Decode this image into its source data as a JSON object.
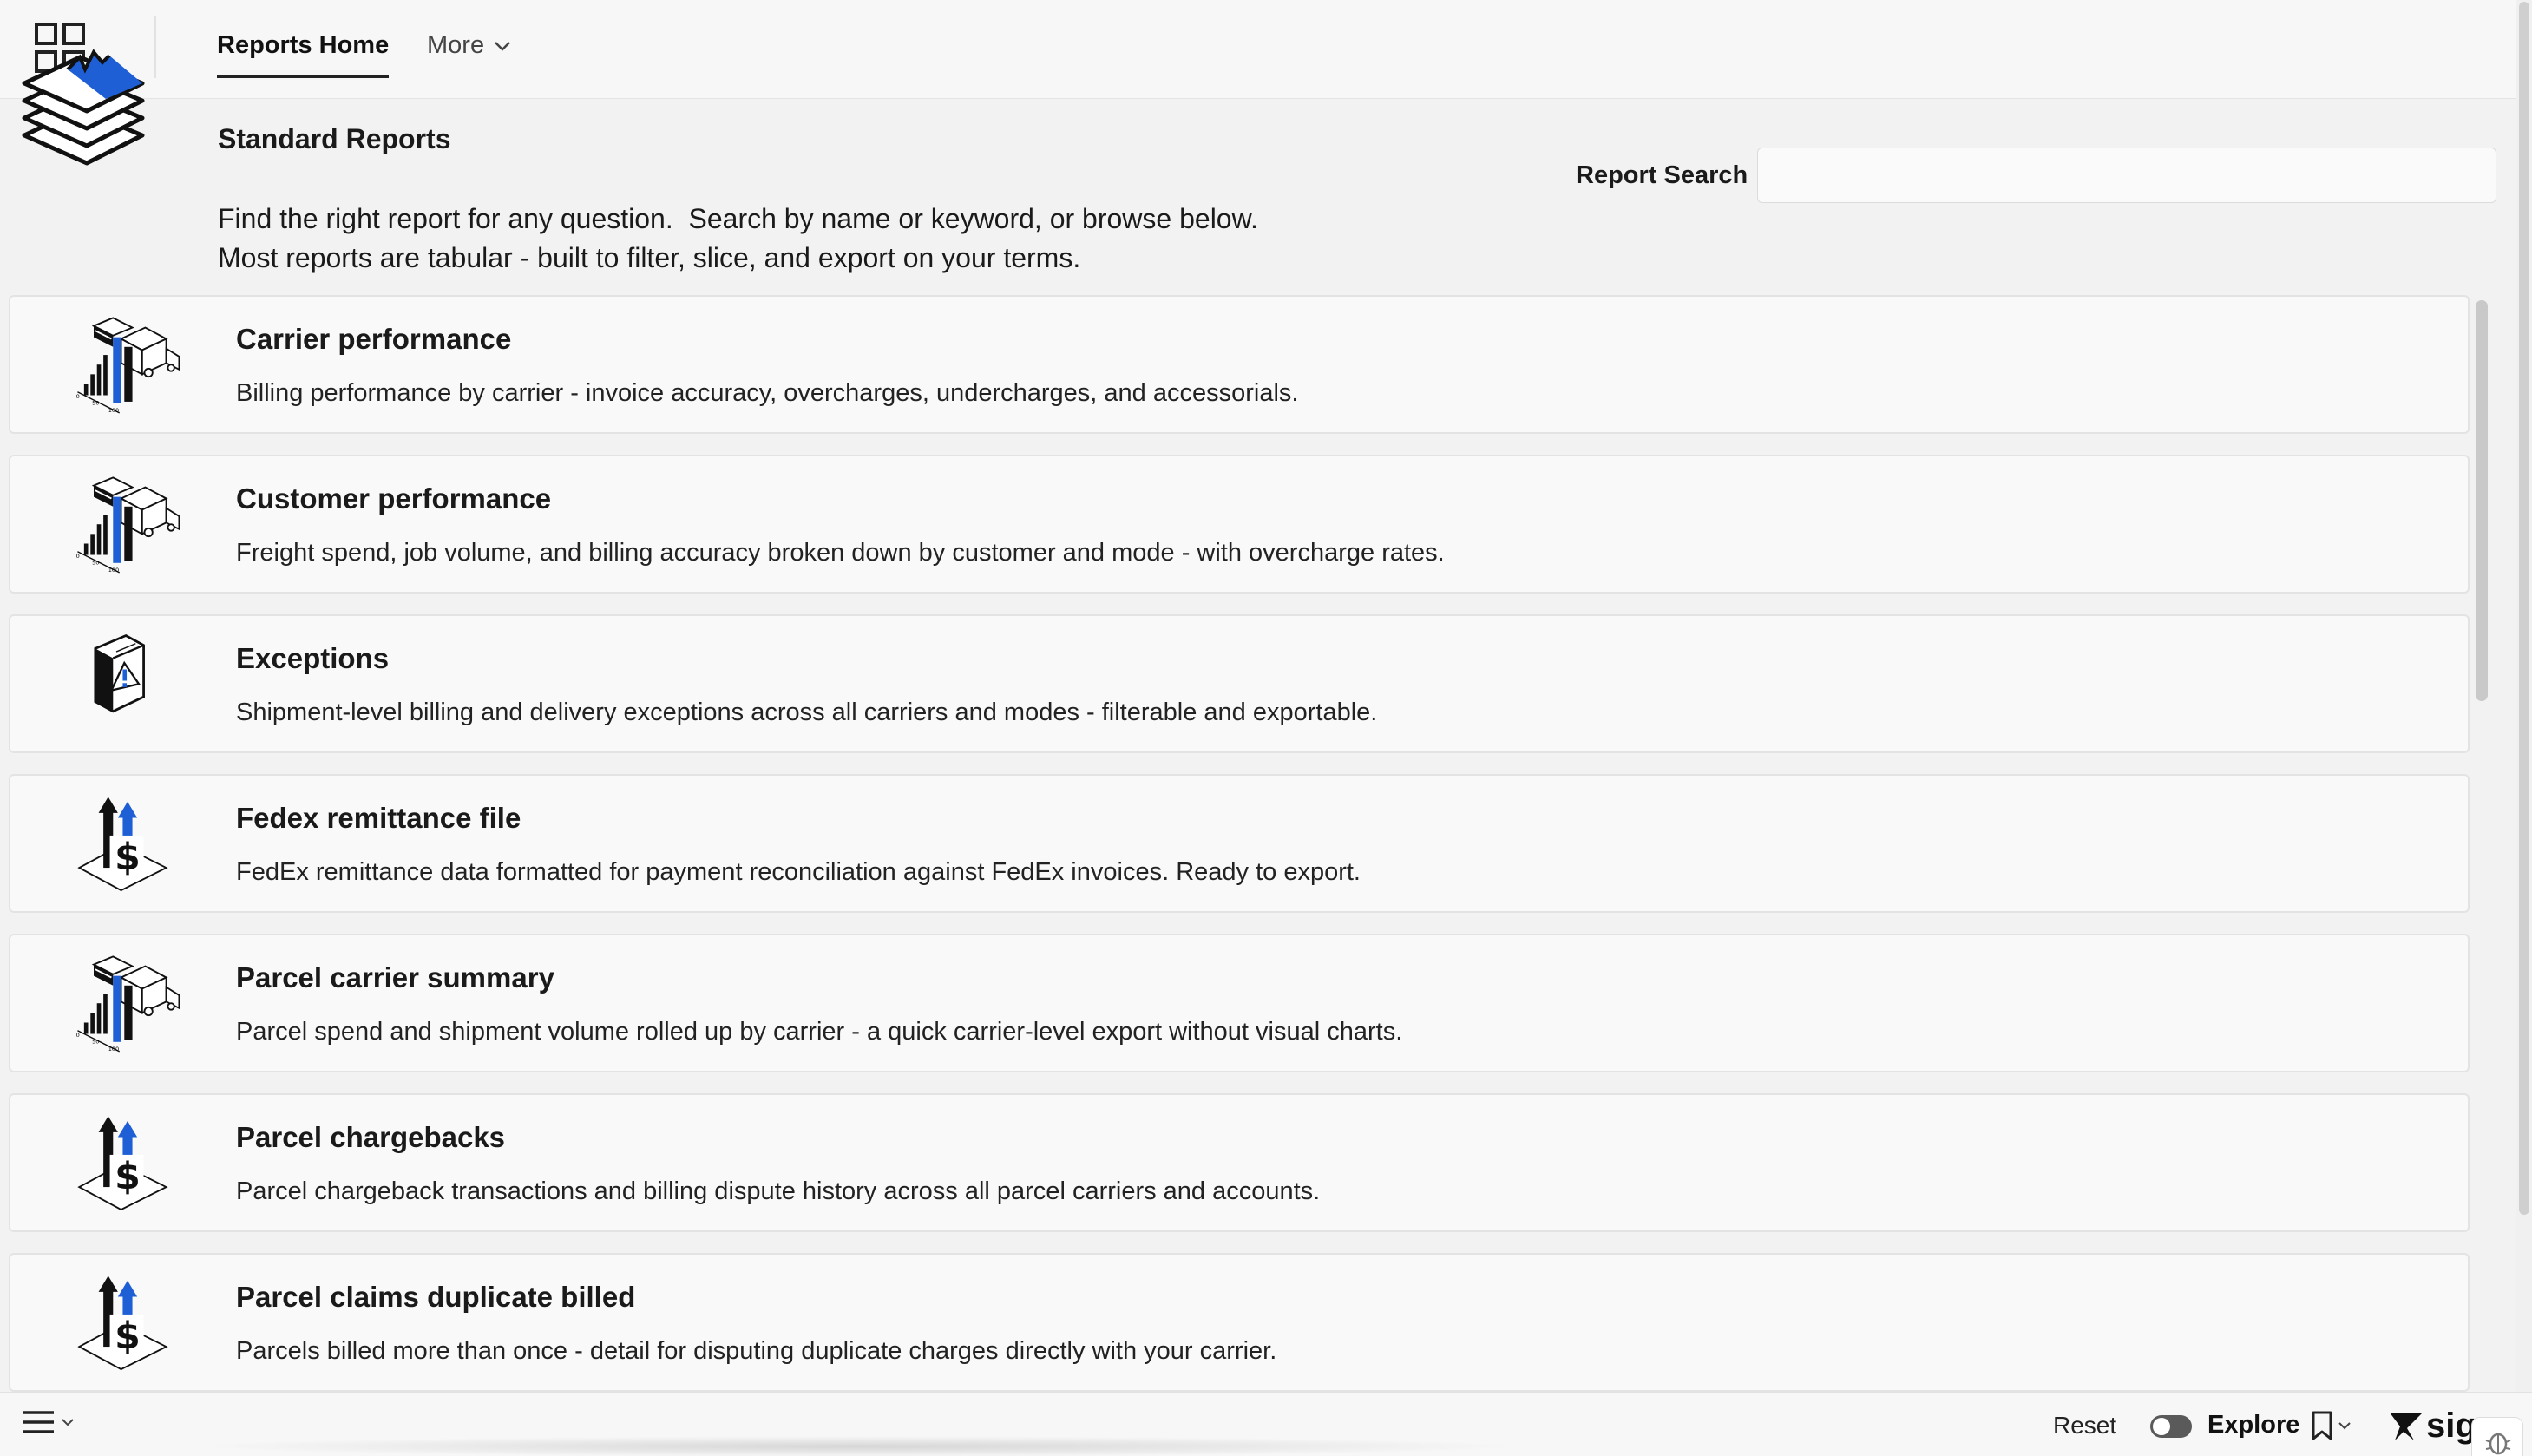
{
  "nav": {
    "home_tab": "Reports Home",
    "more_tab": "More"
  },
  "header": {
    "title": "Standard Reports",
    "description_line1": "Find the right report for any question.  Search by name or keyword, or browse below.",
    "description_line2": "Most reports are tabular - built to filter, slice, and export on your terms.",
    "search_label": "Report Search",
    "search_value": "",
    "search_placeholder": ""
  },
  "reports": [
    {
      "title": "Carrier performance",
      "description": "Billing performance by carrier - invoice accuracy, overcharges, undercharges, and accessorials.",
      "icon": "truck-chart-icon"
    },
    {
      "title": "Customer performance",
      "description": "Freight spend, job volume, and billing accuracy broken down by customer and mode - with overcharge rates.",
      "icon": "truck-chart-icon"
    },
    {
      "title": "Exceptions",
      "description": "Shipment-level billing and delivery exceptions across all carriers and modes - filterable and exportable.",
      "icon": "warning-document-icon"
    },
    {
      "title": "Fedex remittance file",
      "description": "FedEx remittance data formatted for payment reconciliation against FedEx invoices. Ready to export.",
      "icon": "dollar-arrows-icon"
    },
    {
      "title": "Parcel carrier summary",
      "description": "Parcel spend and shipment volume rolled up by carrier - a quick carrier-level export without visual charts.",
      "icon": "truck-chart-icon"
    },
    {
      "title": "Parcel chargebacks",
      "description": "Parcel chargeback transactions and billing dispute history across all parcel carriers and accounts.",
      "icon": "dollar-arrows-icon"
    },
    {
      "title": "Parcel claims duplicate billed",
      "description": "Parcels billed more than once - detail for disputing duplicate charges directly with your carrier.",
      "icon": "dollar-arrows-icon"
    }
  ],
  "footer": {
    "reset_label": "Reset",
    "explore_label": "Explore",
    "brand_text": "sig"
  },
  "colors": {
    "accent_blue": "#1f5fd6",
    "background": "#f2f2f2",
    "card_background": "#f9f9f9"
  }
}
